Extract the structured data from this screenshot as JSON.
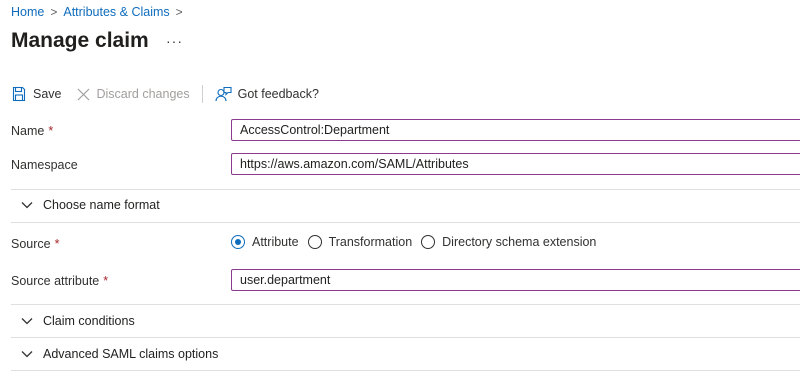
{
  "breadcrumb": {
    "items": [
      {
        "label": "Home"
      },
      {
        "label": "Attributes & Claims"
      }
    ]
  },
  "page": {
    "title": "Manage claim",
    "more_label": "···"
  },
  "toolbar": {
    "save_label": "Save",
    "discard_label": "Discard changes",
    "feedback_label": "Got feedback?"
  },
  "form": {
    "name": {
      "label": "Name",
      "value": "AccessControl:Department"
    },
    "namespace": {
      "label": "Namespace",
      "value": "https://aws.amazon.com/SAML/Attributes"
    },
    "name_format": {
      "label": "Choose name format"
    },
    "source": {
      "label": "Source",
      "selected": "Attribute",
      "options": [
        {
          "label": "Attribute"
        },
        {
          "label": "Transformation"
        },
        {
          "label": "Directory schema extension"
        }
      ]
    },
    "source_attribute": {
      "label": "Source attribute",
      "value": "user.department"
    },
    "required_marker": "*"
  },
  "sections": {
    "claim_conditions": "Claim conditions",
    "advanced_options": "Advanced SAML claims options"
  },
  "colors": {
    "link": "#0f6cbd",
    "input_border": "#8a3b8f",
    "required": "#a4262c",
    "radio_selected": "#0f6cbd"
  }
}
